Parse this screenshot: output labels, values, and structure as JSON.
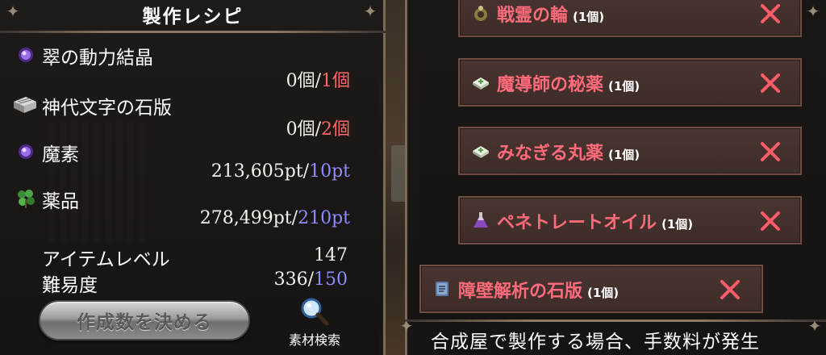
{
  "left_panel": {
    "title": "製作レシピ",
    "materials": [
      {
        "name": "翠の動力結晶",
        "icon": "purple-orb-icon",
        "have": "0個",
        "need": "1個",
        "need_color": "#ff6868"
      },
      {
        "name": "神代文字の石版",
        "icon": "stone-tablet-icon",
        "have": "0個",
        "need": "2個",
        "need_color": "#ff6868"
      },
      {
        "name": "魔素",
        "icon": "purple-orb-icon",
        "have": "213,605pt",
        "need": "10pt",
        "need_color": "#8c8cff"
      },
      {
        "name": "薬品",
        "icon": "herb-icon",
        "have": "278,499pt",
        "need": "210pt",
        "need_color": "#8c8cff"
      }
    ],
    "item_level_label": "アイテムレベル",
    "item_level_value": "147",
    "difficulty_label": "難易度",
    "difficulty_have": "336",
    "difficulty_need": "150",
    "decide_button": "作成数を決める",
    "search_button": "素材検索"
  },
  "right_panel": {
    "recipes": [
      {
        "name": "戦霊の輪",
        "qty": "(1個)",
        "icon": "ring-bag-icon"
      },
      {
        "name": "魔導師の秘薬",
        "qty": "(1個)",
        "icon": "medicine-box-icon"
      },
      {
        "name": "みなぎる丸薬",
        "qty": "(1個)",
        "icon": "medicine-box-icon"
      },
      {
        "name": "ペネトレートオイル",
        "qty": "(1個)",
        "icon": "potion-flask-icon"
      },
      {
        "name": "障壁解析の石版",
        "qty": "(1個)",
        "icon": "blue-tablet-icon"
      }
    ],
    "footer_text": "合成屋で製作する場合、手数料が発生"
  },
  "colors": {
    "recipe_name": "#ff6b7a",
    "close_x": "#ff5c6a",
    "count_red": "#ff6868",
    "count_blue": "#8c8cff"
  }
}
